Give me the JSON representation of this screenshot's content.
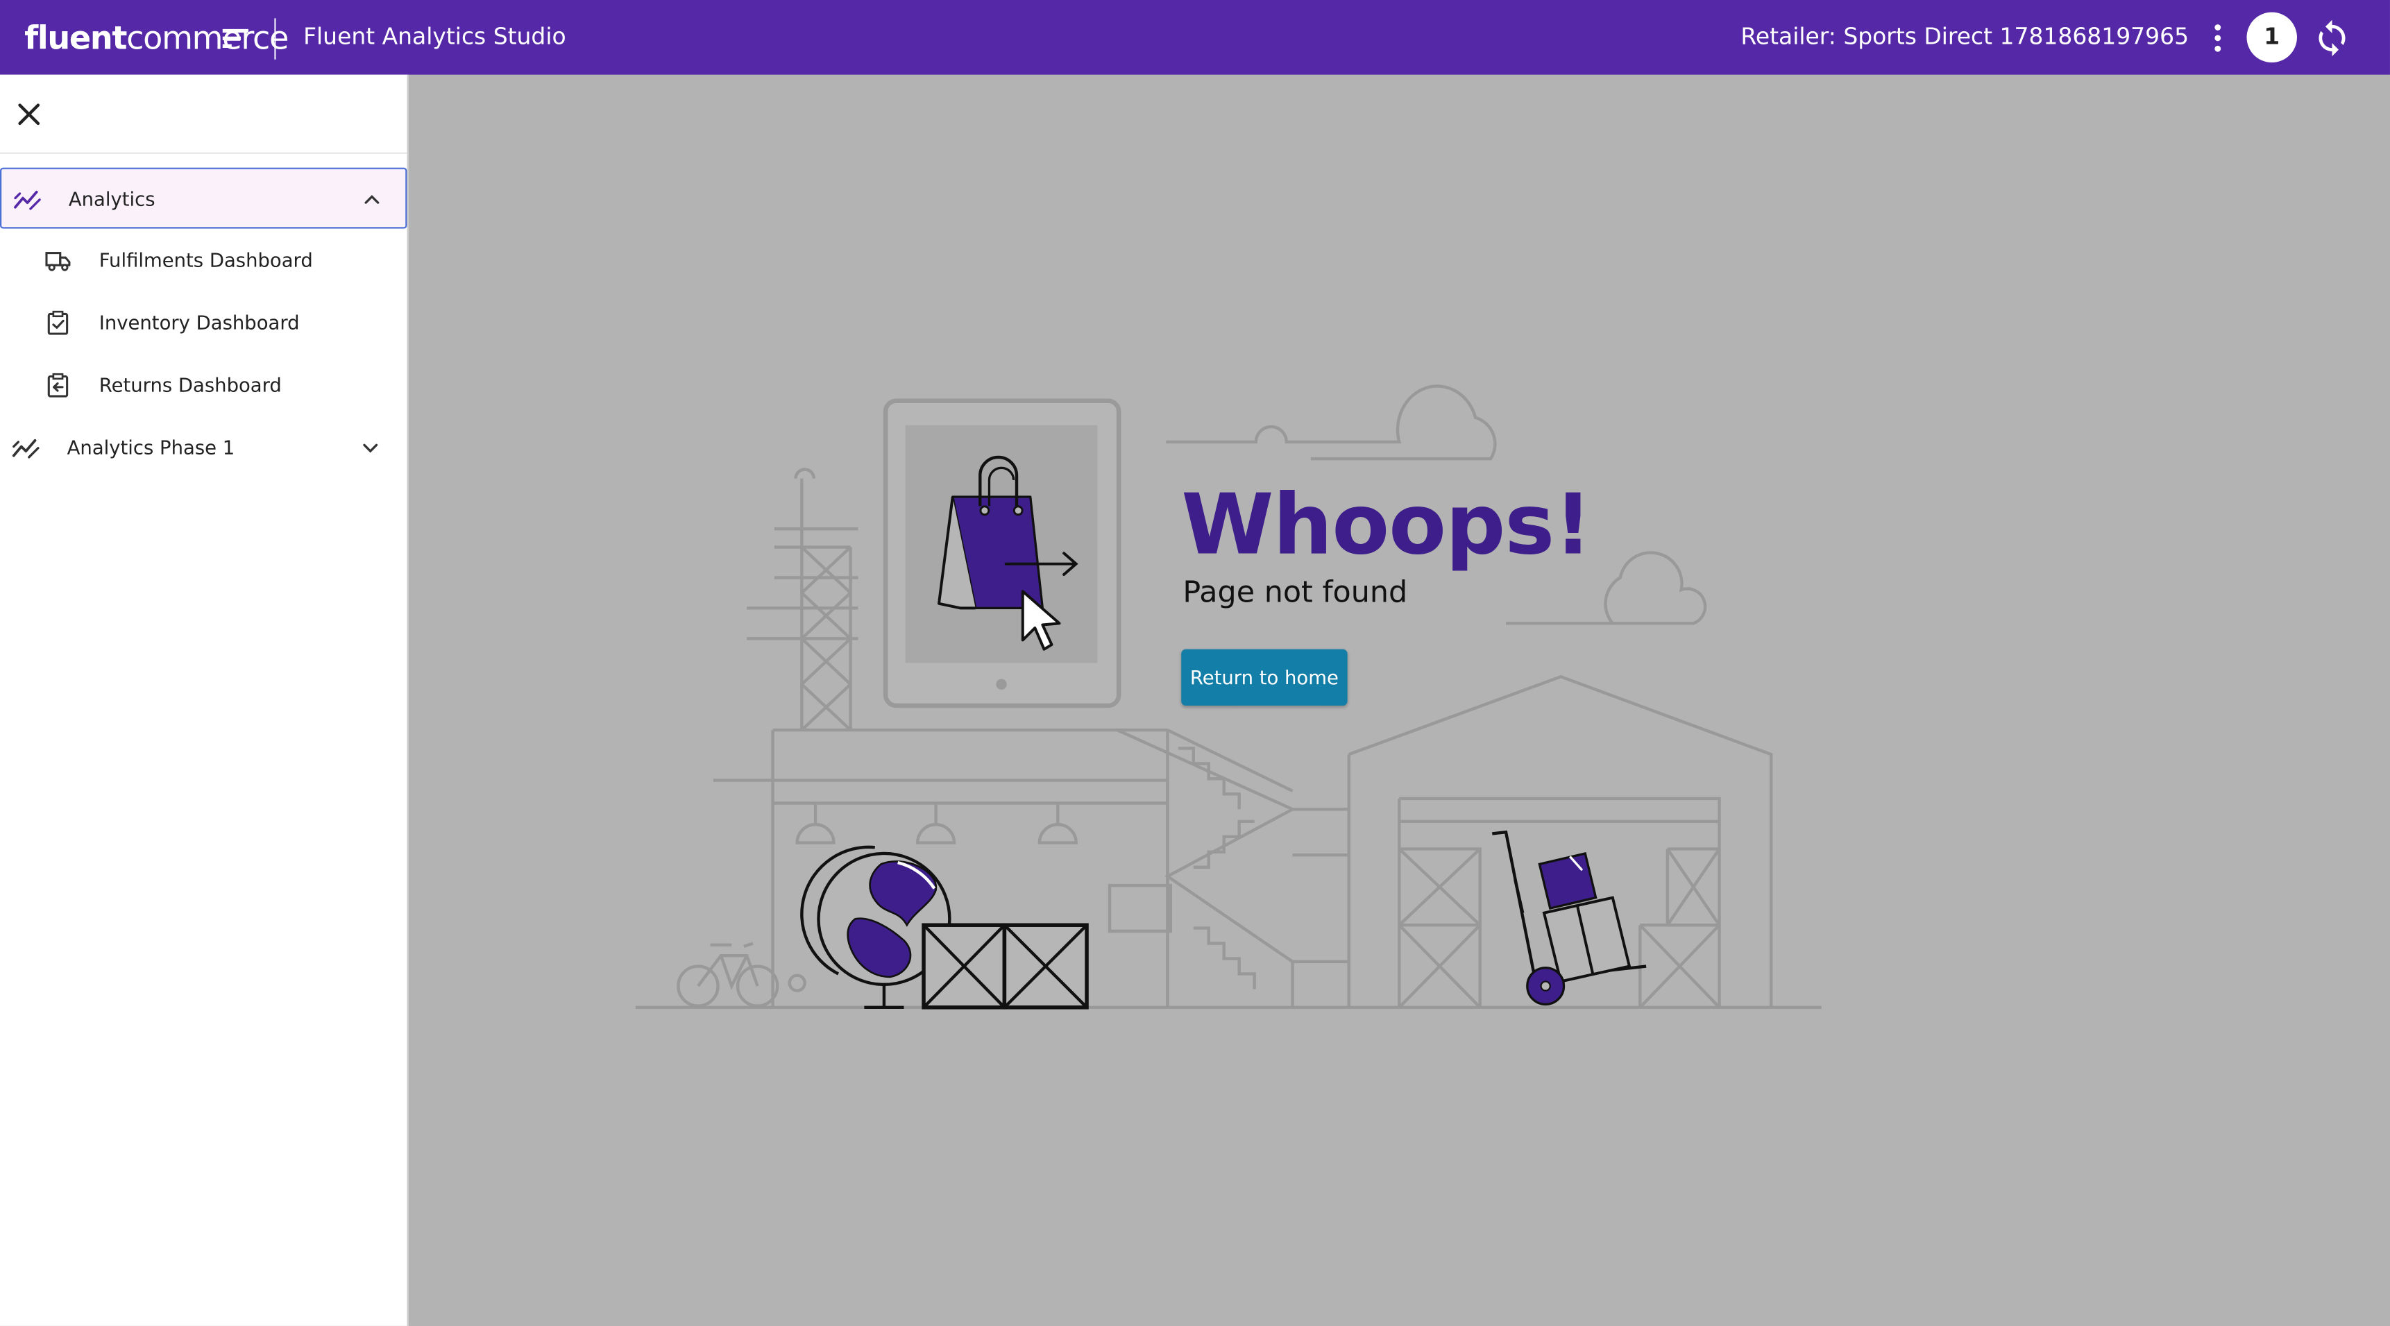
{
  "header": {
    "brand_bold": "fluent",
    "brand_light": "commerce",
    "app_title": "Fluent Analytics Studio",
    "retailer": "Retailer: Sports Direct 1781868197965",
    "notification_count": "1"
  },
  "sidebar": {
    "items": [
      {
        "label": "Analytics",
        "icon": "analytics-icon",
        "expanded": true
      },
      {
        "label": "Fulfilments Dashboard",
        "icon": "truck-icon"
      },
      {
        "label": "Inventory Dashboard",
        "icon": "clipboard-check-icon"
      },
      {
        "label": "Returns Dashboard",
        "icon": "clipboard-return-icon"
      },
      {
        "label": "Analytics Phase 1",
        "icon": "analytics-icon",
        "expanded": false
      }
    ]
  },
  "error": {
    "heading": "Whoops!",
    "message": "Page not found",
    "button_label": "Return to home"
  },
  "colors": {
    "header_bg": "#5528a8",
    "accent_purple": "#3d1e8a",
    "button_bg": "#137ea8",
    "overlay_bg": "#b3b3b3"
  }
}
